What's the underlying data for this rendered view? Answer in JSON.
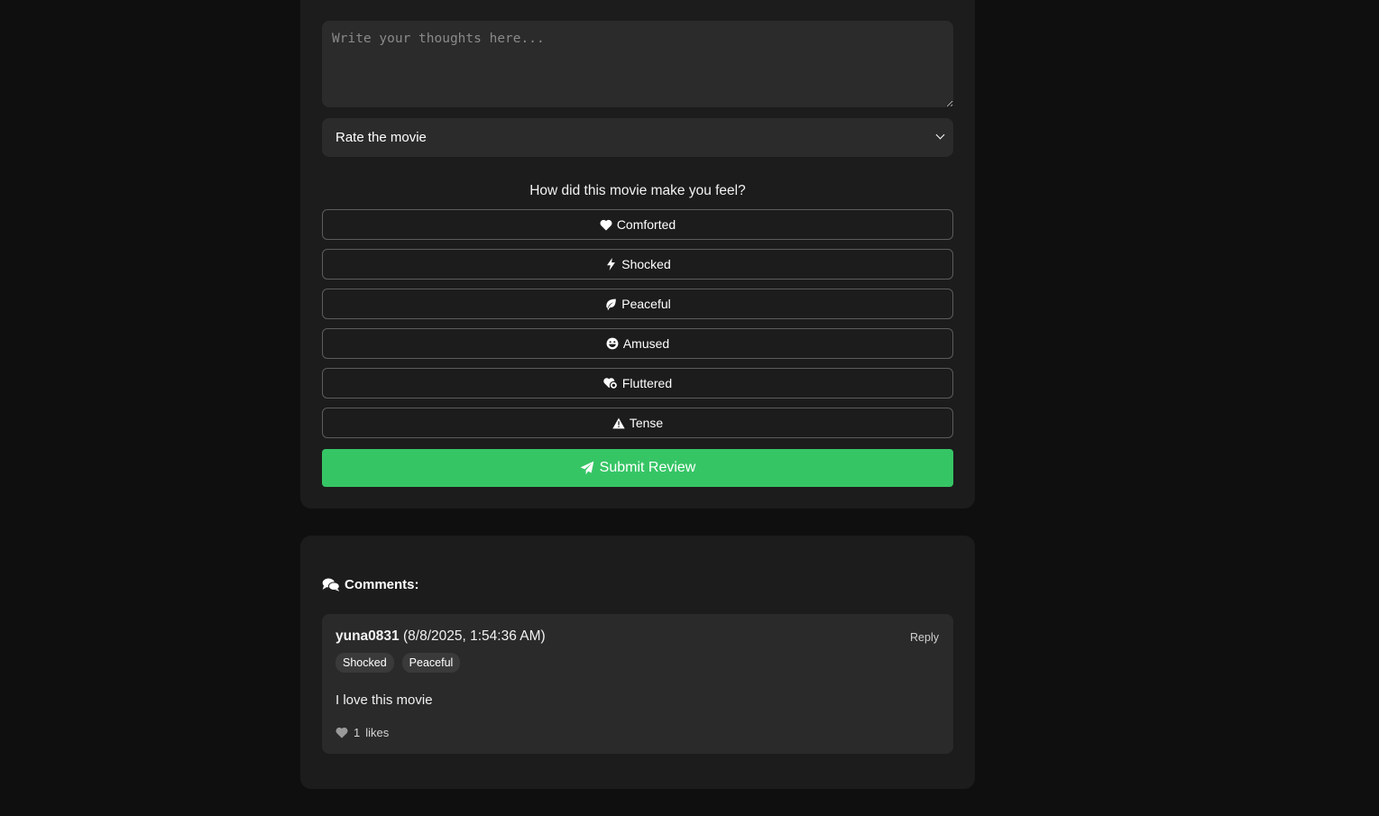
{
  "review_form": {
    "thoughts_placeholder": "Write your thoughts here...",
    "rating_select_value": "Rate the movie",
    "feel_question": "How did this movie make you feel?",
    "moods": [
      {
        "label": "Comforted",
        "icon": "heart-icon"
      },
      {
        "label": "Shocked",
        "icon": "bolt-icon"
      },
      {
        "label": "Peaceful",
        "icon": "leaf-icon"
      },
      {
        "label": "Amused",
        "icon": "grin-icon"
      },
      {
        "label": "Fluttered",
        "icon": "heart-circle-icon"
      },
      {
        "label": "Tense",
        "icon": "warning-icon"
      }
    ],
    "submit_label": "Submit Review",
    "submit_color": "#36c565"
  },
  "comments": {
    "title": "Comments:",
    "items": [
      {
        "user": "yuna0831",
        "timestamp": "(8/8/2025, 1:54:36 AM)",
        "reply_label": "Reply",
        "tags": [
          "Shocked",
          "Peaceful"
        ],
        "text": "I love this movie",
        "likes_count": "1",
        "likes_label": "likes"
      }
    ]
  }
}
